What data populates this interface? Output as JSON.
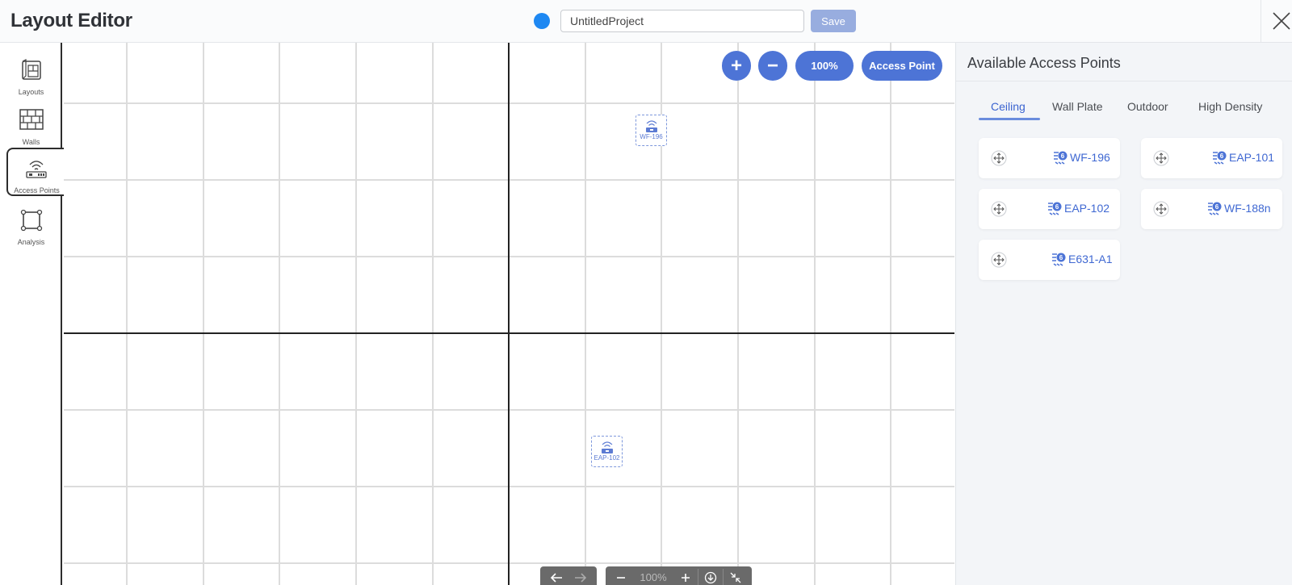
{
  "header": {
    "title": "Layout Editor",
    "status_color": "#1e88f2",
    "project_name": "UntitledProject",
    "save_label": "Save",
    "close_icon": "close-icon"
  },
  "rail": {
    "items": [
      {
        "label": "Layouts",
        "icon": "floorplan-icon"
      },
      {
        "label": "Walls",
        "icon": "brick-wall-icon"
      },
      {
        "label": "Access Points",
        "icon": "wifi-router-icon",
        "active": true
      },
      {
        "label": "Analysis",
        "icon": "square-nodes-icon"
      }
    ]
  },
  "canvas": {
    "zoom_in_label": "+",
    "zoom_out_label": "−",
    "zoom_level": "100%",
    "add_ap_label": "Access Point",
    "placed_aps": [
      {
        "label": "WF-196"
      },
      {
        "label": "EAP-102"
      }
    ],
    "bottom_bar": {
      "zoom_level": "100%",
      "undo_icon": "arrow-left-icon",
      "redo_icon": "arrow-right-icon",
      "zoom_out_icon": "minus-icon",
      "zoom_in_icon": "plus-icon",
      "download_icon": "download-icon",
      "collapse_icon": "collapse-icon"
    }
  },
  "panel": {
    "title": "Available Access Points",
    "tabs": [
      "Ceiling",
      "Wall Plate",
      "Outdoor",
      "High Density"
    ],
    "active_tab": "Ceiling",
    "access_points": [
      {
        "name": "WF-196"
      },
      {
        "name": "EAP-101"
      },
      {
        "name": "EAP-102"
      },
      {
        "name": "WF-188n"
      },
      {
        "name": "E631-A1"
      }
    ]
  },
  "colors": {
    "accent": "#4d74d6",
    "tab_active": "#3b64d0",
    "save_disabled": "#98addf"
  }
}
